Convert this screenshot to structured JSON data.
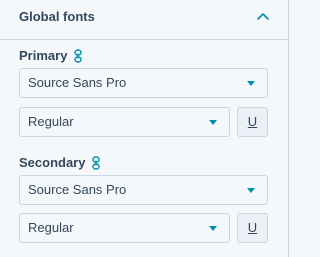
{
  "header": {
    "title": "Global fonts",
    "collapse_icon": "chevron-up-icon"
  },
  "primary": {
    "label": "Primary",
    "link_icon": "link-icon",
    "font_family": "Source Sans Pro",
    "font_weight": "Regular",
    "underline_label": "U"
  },
  "secondary": {
    "label": "Secondary",
    "link_icon": "link-icon",
    "font_family": "Source Sans Pro",
    "font_weight": "Regular",
    "underline_label": "U"
  },
  "colors": {
    "accent": "#0091ae",
    "text": "#33475b",
    "border": "#cbd6e2"
  }
}
